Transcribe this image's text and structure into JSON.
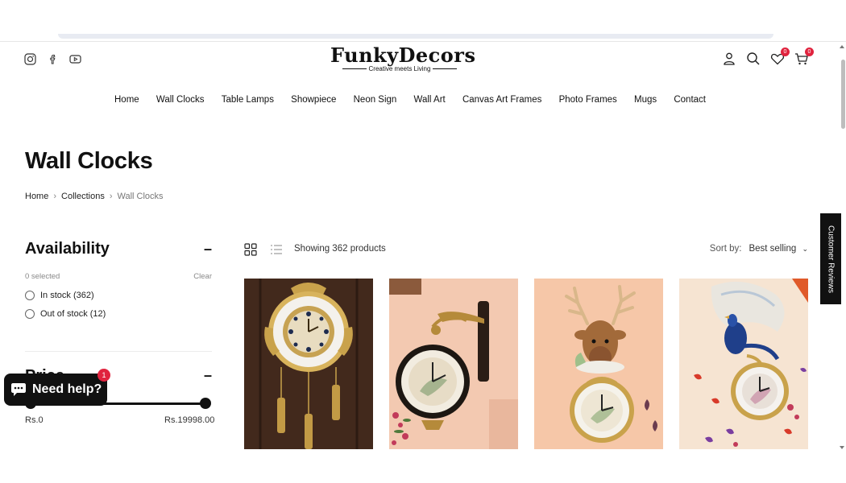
{
  "brand": {
    "name": "FunkyDecors",
    "tagline": "Creative meets Living"
  },
  "social": [
    "instagram-icon",
    "facebook-icon",
    "youtube-icon"
  ],
  "header_icons": {
    "wishlist_count": "0",
    "cart_count": "0"
  },
  "nav": [
    "Home",
    "Wall Clocks",
    "Table Lamps",
    "Showpiece",
    "Neon Sign",
    "Wall Art",
    "Canvas Art Frames",
    "Photo Frames",
    "Mugs",
    "Contact"
  ],
  "page": {
    "title": "Wall Clocks"
  },
  "breadcrumb": [
    "Home",
    "Collections",
    "Wall Clocks"
  ],
  "filters": {
    "availability": {
      "title": "Availability",
      "selected": "0 selected",
      "clear": "Clear",
      "options": [
        "In stock (362)",
        "Out of stock (12)"
      ]
    },
    "price": {
      "min": "Rs.0",
      "max": "Rs.19998.00"
    }
  },
  "toolbar": {
    "count": "Showing 362 products",
    "sort_label": "Sort by:",
    "sort_value": "Best selling"
  },
  "help_widget": {
    "label": "Need help?",
    "badge": "1"
  },
  "reviews_tab": "Customer Reviews",
  "colors": {
    "accent": "#e0233e",
    "dark": "#111111"
  }
}
